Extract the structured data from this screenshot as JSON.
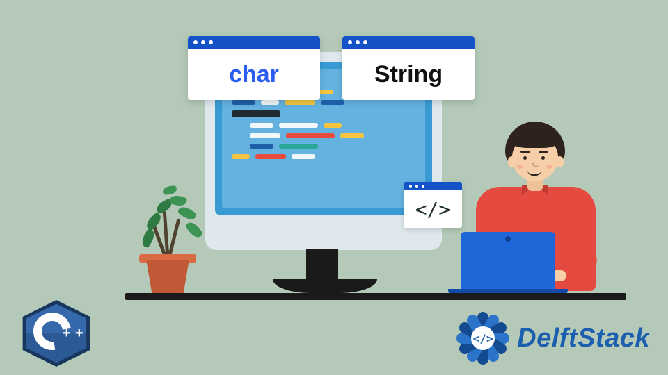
{
  "windows": {
    "char_label": "char",
    "string_label": "String",
    "code_tag_glyph": "</>"
  },
  "logos": {
    "cpp_plus": "+",
    "delftstack_text": "DelftStack",
    "delftstack_glyph": "</>"
  },
  "colors": {
    "background": "#b4c9b8",
    "accent_blue": "#1453c7",
    "char_text": "#2a5df0",
    "shirt": "#e44a3f",
    "laptop": "#1f66d9",
    "brand": "#1c5fae"
  },
  "icons": {
    "window_char": "window-char",
    "window_string": "window-string",
    "code_tag": "code-tag-icon",
    "cpp_logo": "cpp-logo",
    "delftstack_logo": "delftstack-logo",
    "monitor": "monitor-illustration",
    "plant": "plant-illustration",
    "person": "person-illustration",
    "laptop": "laptop-illustration"
  }
}
